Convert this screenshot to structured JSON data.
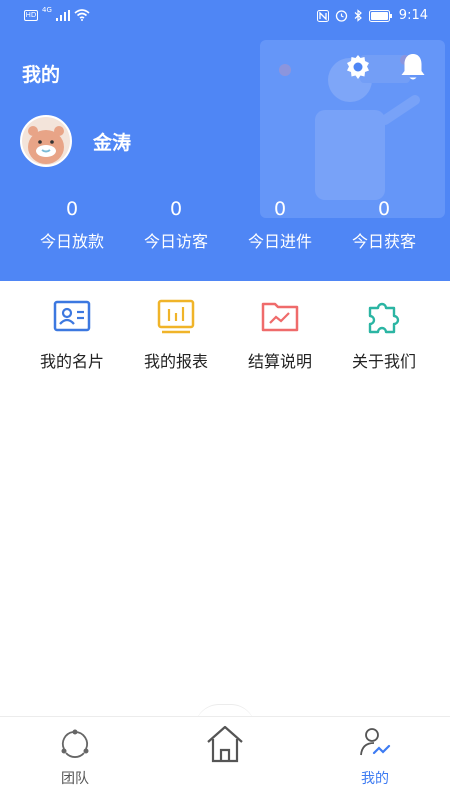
{
  "status_bar": {
    "left_icons": [
      "hd-icon",
      "signal-icon",
      "wifi-icon"
    ],
    "right_icons": [
      "nfc-icon",
      "alarm-icon",
      "bluetooth-icon",
      "battery-icon"
    ],
    "network": "4G",
    "hd": "HD",
    "time": "9:14"
  },
  "header": {
    "title": "我的",
    "settings_icon": "gear-icon",
    "notification_icon": "bell-icon",
    "bg_color": "#4f86f5"
  },
  "profile": {
    "name": "金涛"
  },
  "stats": [
    {
      "value": "0",
      "label": "今日放款"
    },
    {
      "value": "0",
      "label": "今日访客"
    },
    {
      "value": "0",
      "label": "今日进件"
    },
    {
      "value": "0",
      "label": "今日获客"
    }
  ],
  "menu": [
    {
      "label": "我的名片",
      "icon": "business-card-icon",
      "color": "#3c78e0"
    },
    {
      "label": "我的报表",
      "icon": "report-icon",
      "color": "#f0b429"
    },
    {
      "label": "结算说明",
      "icon": "settlement-folder-icon",
      "color": "#ef6b6b"
    },
    {
      "label": "关于我们",
      "icon": "puzzle-icon",
      "color": "#2bb5a3"
    }
  ],
  "tabbar": {
    "tabs": [
      {
        "label": "团队",
        "icon": "team-icon"
      },
      {
        "label": "",
        "icon": "home-icon"
      },
      {
        "label": "我的",
        "icon": "profile-icon"
      }
    ],
    "active_color": "#3d7bf2"
  }
}
